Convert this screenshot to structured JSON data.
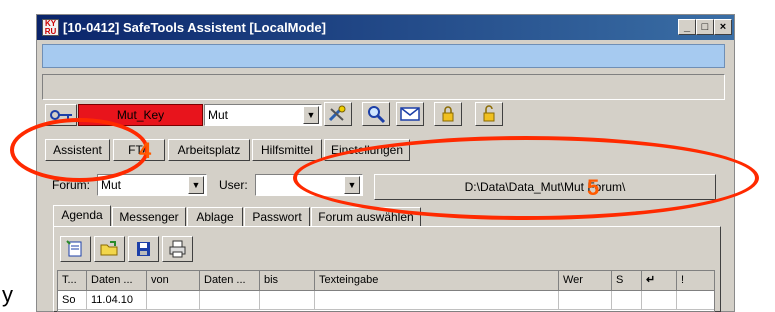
{
  "window": {
    "title": "[10-0412] SafeTools Assistent [LocalMode]",
    "controls": [
      "_",
      "□",
      "×"
    ]
  },
  "toolbar": {
    "key_name": "Mut_Key",
    "user_select": "Mut",
    "icons": [
      "key-icon",
      "tools-icon",
      "magnifier-icon",
      "envelope-icon",
      "lock-icon",
      "padlock-icon"
    ]
  },
  "nav_buttons": [
    "Assistent",
    "FTA",
    "Arbeitsplatz",
    "Hilfsmittel",
    "Einstellungen"
  ],
  "forum": {
    "forum_label": "Forum:",
    "forum_value": "Mut",
    "user_label": "User:",
    "user_value": "",
    "path": "D:\\Data\\Data_Mut\\Mut Forum\\"
  },
  "tabs": [
    "Agenda",
    "Messenger",
    "Ablage",
    "Passwort",
    "Forum auswählen"
  ],
  "agenda": {
    "toolbar_icons": [
      "new-entry-icon",
      "open-folder-icon",
      "save-disk-icon",
      "print-icon"
    ],
    "columns": [
      "T...",
      "Daten ...",
      "von",
      "Daten ...",
      "bis",
      "Texteingabe",
      "Wer",
      "S",
      "↵",
      "!"
    ],
    "rows": [
      [
        "So",
        "11.04.10",
        "",
        "",
        "",
        "",
        "",
        "",
        "",
        ""
      ]
    ]
  },
  "annotations": {
    "marker_4": "4",
    "marker_5": "5",
    "marker_color": "#ff2a00"
  },
  "fragments": {
    "left_edge": "y"
  }
}
